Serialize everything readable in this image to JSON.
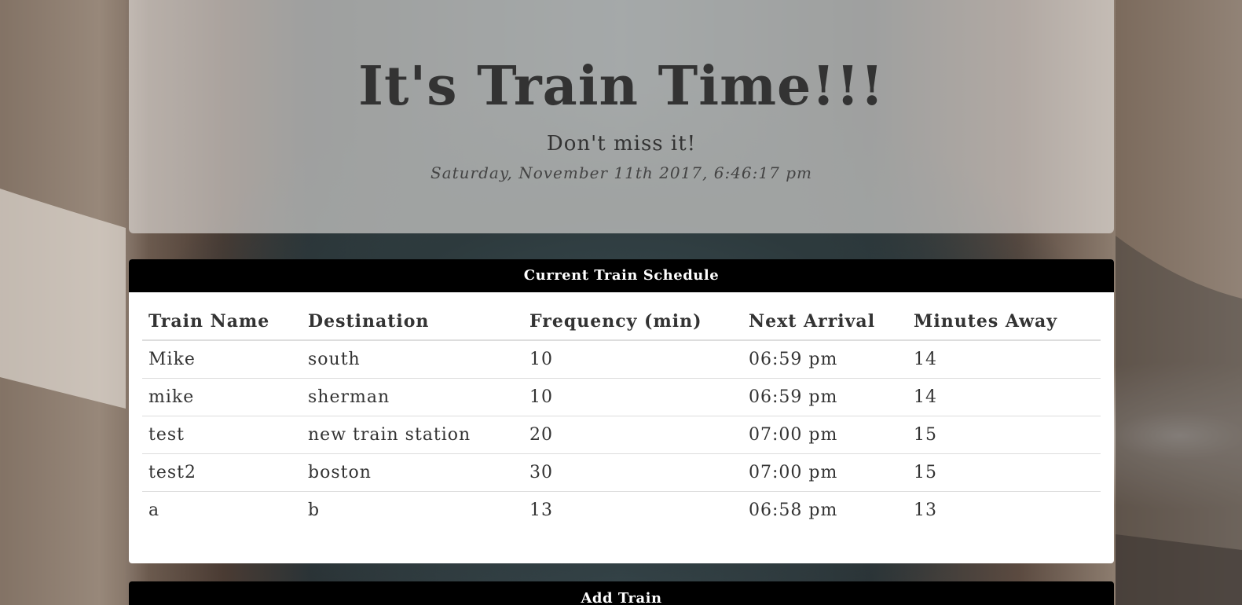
{
  "header": {
    "title": "It's Train Time!!!",
    "tagline": "Don't miss it!",
    "datetime": "Saturday, November 11th 2017, 6:46:17 pm"
  },
  "schedule": {
    "heading": "Current Train Schedule",
    "columns": [
      "Train Name",
      "Destination",
      "Frequency (min)",
      "Next Arrival",
      "Minutes Away"
    ],
    "rows": [
      [
        "Mike",
        "south",
        "10",
        "06:59 pm",
        "14"
      ],
      [
        "mike",
        "sherman",
        "10",
        "06:59 pm",
        "14"
      ],
      [
        "test",
        "new train station",
        "20",
        "07:00 pm",
        "15"
      ],
      [
        "test2",
        "boston",
        "30",
        "07:00 pm",
        "15"
      ],
      [
        "a",
        "b",
        "13",
        "06:58 pm",
        "13"
      ]
    ]
  },
  "add_train": {
    "heading": "Add Train"
  },
  "colors": {
    "panel_heading_bg": "#000000",
    "panel_heading_text": "#ffffff",
    "jumbotron_bg": "#e6e4e0"
  }
}
